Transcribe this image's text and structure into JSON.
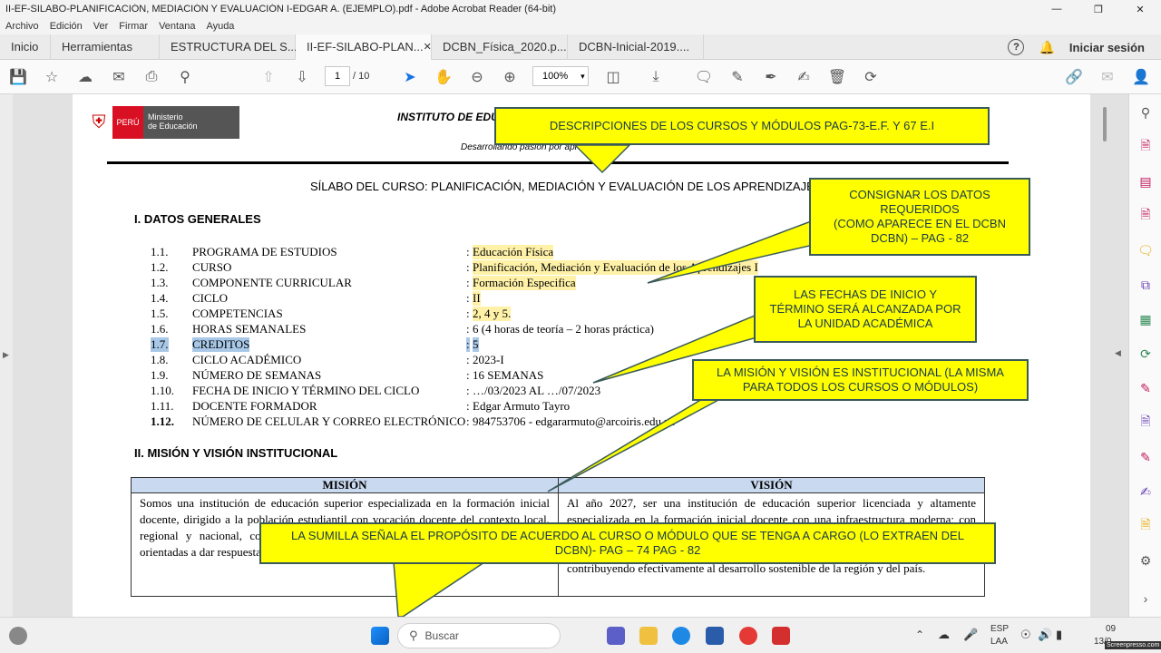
{
  "window": {
    "title": "II-EF-SILABO-PLANIFICACIÓN, MEDIACIÓN Y EVALUACIÓN I-EDGAR A. (EJEMPLO).pdf - Adobe Acrobat Reader (64-bit)"
  },
  "menu": [
    "Archivo",
    "Edición",
    "Ver",
    "Firmar",
    "Ventana",
    "Ayuda"
  ],
  "tabs": {
    "home": "Inicio",
    "tools": "Herramientas",
    "docs": [
      "ESTRUCTURA DEL S...",
      "II-EF-SILABO-PLAN...",
      "DCBN_Física_2020.p...",
      "DCBN-Inicial-2019...."
    ],
    "login": "Iniciar sesión"
  },
  "toolbar": {
    "page_current": "1",
    "page_total": "/ 10",
    "zoom": "100%"
  },
  "doc": {
    "institute": "INSTITUTO DE EDUC",
    "logo_country": "PERÚ",
    "logo_ministry": "Ministerio\nde Educación",
    "motto": "Desarrollando pasión por apr",
    "title": "SÍLABO DEL CURSO: PLANIFICACIÓN, MEDIACIÓN Y EVALUACIÓN DE LOS APRENDIZAJES I",
    "section1": "I.   DATOS GENERALES",
    "rows": [
      {
        "num": "1.1.",
        "label": "PROGRAMA DE ESTUDIOS",
        "colon": ": ",
        "value": "Educación Física",
        "hl": true
      },
      {
        "num": "1.2.",
        "label": "CURSO",
        "colon": ": ",
        "value": "Planificación, Mediación y Evaluación de los Aprendizajes I",
        "hl": true
      },
      {
        "num": "1.3.",
        "label": "COMPONENTE CURRICULAR",
        "colon": ": ",
        "value": "Formación Especifica",
        "hl": true
      },
      {
        "num": "1.4.",
        "label": "CICLO",
        "colon": ": ",
        "value": "II",
        "hl": true
      },
      {
        "num": "1.5.",
        "label": "COMPETENCIAS",
        "colon": ": ",
        "value": "2, 4 y 5.",
        "hl": true
      },
      {
        "num": "1.6.",
        "label": "HORAS SEMANALES",
        "colon": ": ",
        "value": "6 (4 horas de teoría – 2 horas práctica)",
        "hl": false
      },
      {
        "num": "1.7.",
        "label": "CREDITOS",
        "colon": ": ",
        "value": "5",
        "hl": false,
        "sel": true
      },
      {
        "num": "1.8.",
        "label": "CICLO ACADÉMICO",
        "colon": ": ",
        "value": "2023-I",
        "hl": false
      },
      {
        "num": "1.9.",
        "label": "NÚMERO DE SEMANAS",
        "colon": ": ",
        "value": "16 SEMANAS",
        "hl": false
      },
      {
        "num": "1.10.",
        "label": "FECHA DE INICIO Y TÉRMINO DEL CICLO",
        "colon": ": ",
        "value": "…/03/2023 AL …/07/2023",
        "hl": false
      },
      {
        "num": "1.11.",
        "label": "DOCENTE FORMADOR",
        "colon": ": ",
        "value": "Edgar Armuto Tayro",
        "hl": false
      },
      {
        "num": "1.12.",
        "label": "NÚMERO DE CELULAR Y CORREO ELECTRÓNICO",
        "colon": ": ",
        "value": "984753706 - edgararmuto@arcoiris.edu.pe",
        "hl": false,
        "boldnum": true
      }
    ],
    "section2": "II.  MISIÓN Y VISIÓN INSTITUCIONAL",
    "mision_header": "MISIÓN",
    "vision_header": "VISIÓN",
    "mision_text": "Somos una institución de educación superior especializada en la formación inicial docente, dirigido a la población estudiantil con vocación docente del contexto local, regional y nacional, con pensamiento crítico reflexivo, la práctica pedagógica, orientadas a dar respuesta a las necesidades educativos.",
    "vision_text": "Al año 2027, ser una institución de educación superior licenciada y altamente especializada en la formación inicial docente con una infraestructura moderna; con docentes competentes, comprometidos con la innovación e investigación; y egresados que se desempeñen eficientemente como profesionales y como persona, contribuyendo efectivamente al desarrollo sostenible de la región y del país."
  },
  "callouts": {
    "c1": "DESCRIPCIONES DE LOS CURSOS Y MÓDULOS PAG-73-E.F. Y 67 E.I",
    "c2": "CONSIGNAR LOS DATOS REQUERIDOS\n(COMO APARECE EN EL DCBN DCBN) – PAG - 82",
    "c3": "LAS FECHAS DE INICIO Y TÉRMINO SERÁ ALCANZADA POR LA UNIDAD ACADÉMICA",
    "c4": "LA MISIÓN Y VISIÓN ES INSTITUCIONAL (LA MISMA PARA TODOS LOS CURSOS O MÓDULOS)",
    "c5": "LA SUMILLA SEÑALA EL PROPÓSITO DE ACUERDO AL CURSO O MÓDULO QUE SE TENGA A CARGO (LO EXTRAEN DEL DCBN)- PAG – 74       PAG - 82"
  },
  "taskbar": {
    "search": "Buscar",
    "lang1": "ESP",
    "lang2": "LAA",
    "time": "09",
    "date": "13/0",
    "watermark": "Screenpresso.com"
  }
}
